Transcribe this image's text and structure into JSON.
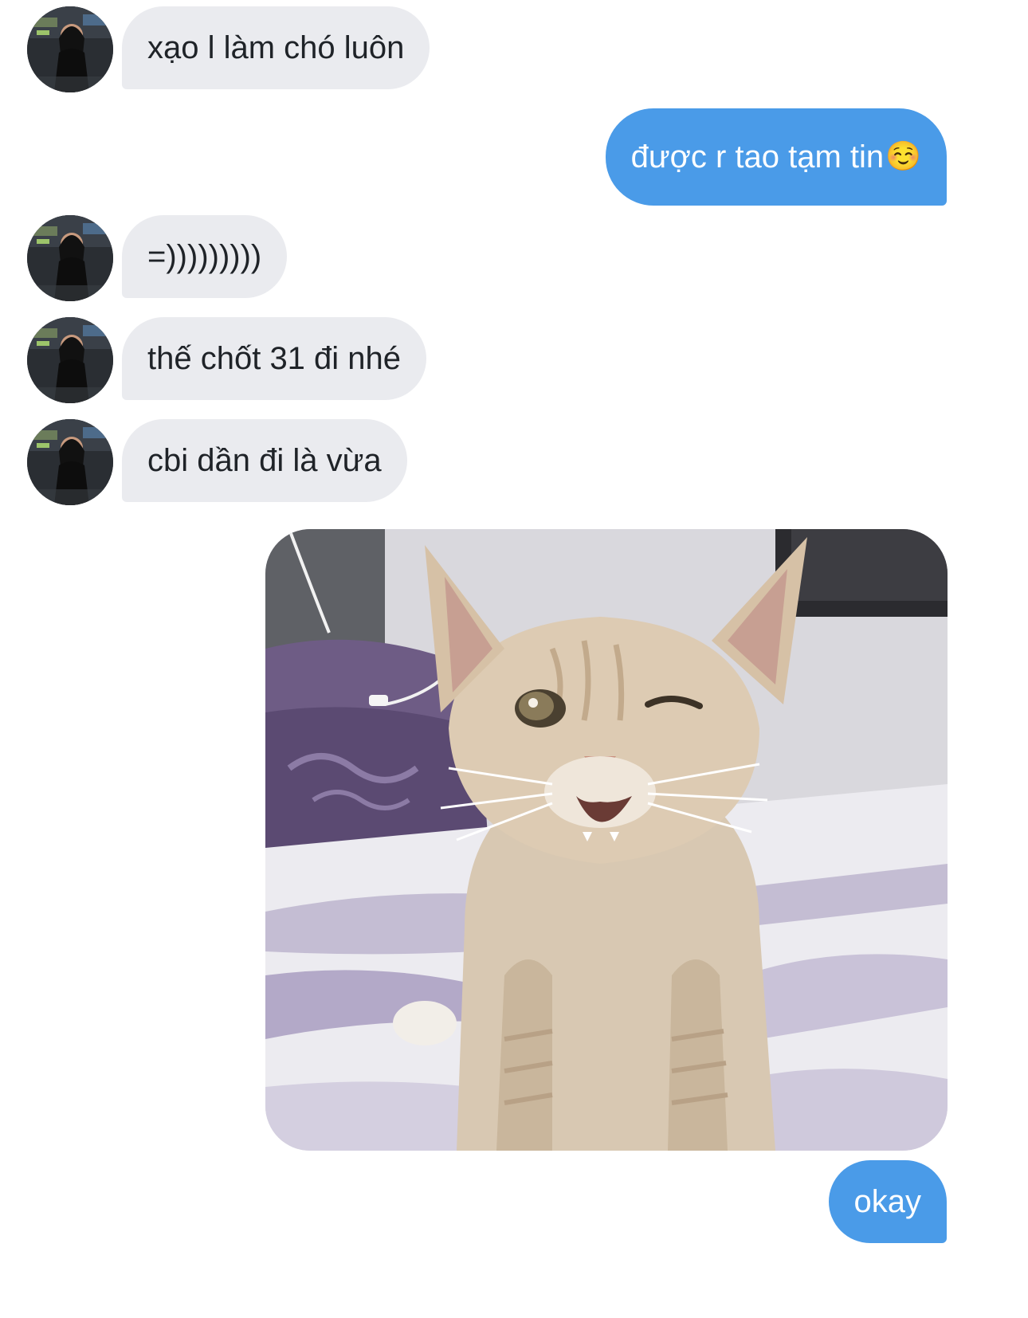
{
  "conversation": {
    "messages": [
      {
        "sender": "them",
        "text": "xạo l làm chó luôn"
      },
      {
        "sender": "me",
        "text": "được r tao tạm tin",
        "emoji": "☺️"
      },
      {
        "sender": "them",
        "text": "=)))))))))"
      },
      {
        "sender": "them",
        "text": "thế chốt 31 đi nhé"
      },
      {
        "sender": "them",
        "text": "cbi dần đi là vừa"
      },
      {
        "sender": "me",
        "type": "image",
        "icon": "winking-kitten-photo"
      },
      {
        "sender": "me",
        "text": "okay"
      }
    ]
  },
  "colors": {
    "incoming_bubble": "#eaebef",
    "outgoing_bubble": "#4a9be8",
    "incoming_text": "#1f2328",
    "outgoing_text": "#ffffff",
    "background": "#ffffff"
  },
  "icons": {
    "avatar": "user-avatar-photo",
    "image_message": "kitten-photo"
  }
}
